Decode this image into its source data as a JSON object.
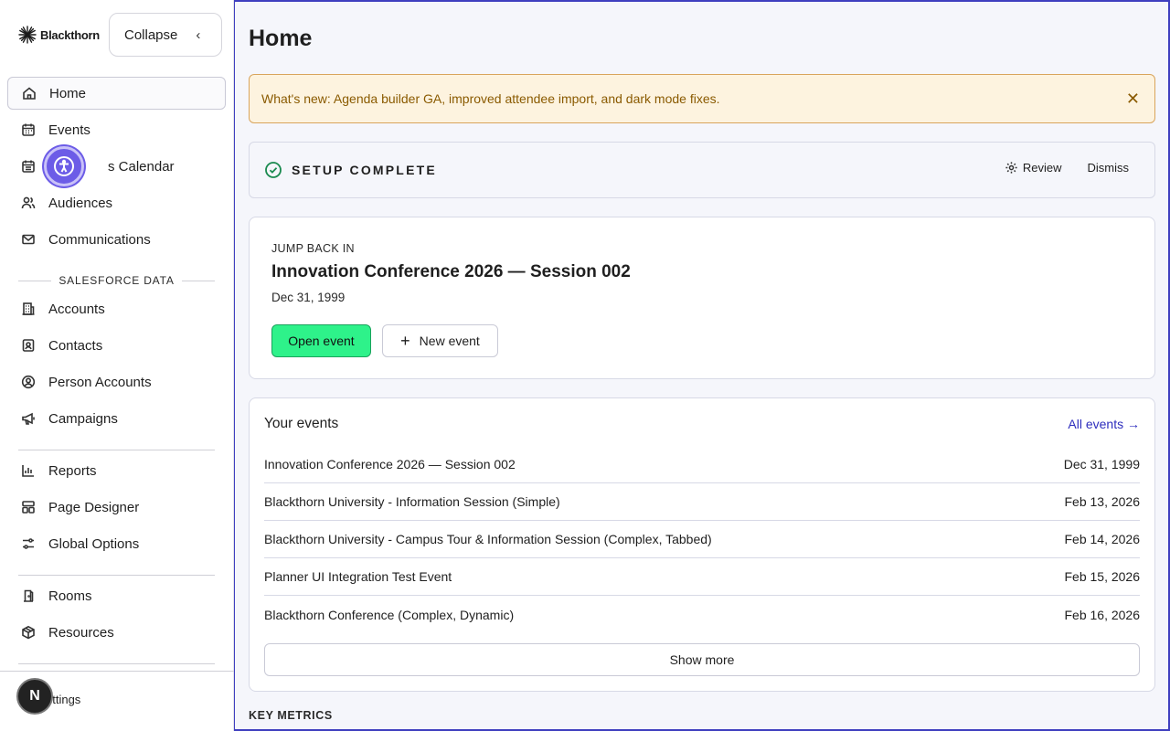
{
  "brand": {
    "name": "Blackthorn"
  },
  "sidebar": {
    "collapse_label": "Collapse",
    "primary": [
      {
        "label": "Home",
        "icon": "home-icon"
      },
      {
        "label": "Events",
        "icon": "calendar-icon"
      },
      {
        "label": "Events Calendar",
        "icon": "calendar-icon",
        "visible_label": "s Calendar"
      },
      {
        "label": "Audiences",
        "icon": "users-icon"
      },
      {
        "label": "Communications",
        "icon": "mail-icon"
      }
    ],
    "salesforce_section_title": "SALESFORCE DATA",
    "salesforce": [
      {
        "label": "Accounts",
        "icon": "building-icon"
      },
      {
        "label": "Contacts",
        "icon": "contact-icon"
      },
      {
        "label": "Person Accounts",
        "icon": "person-circle-icon"
      },
      {
        "label": "Campaigns",
        "icon": "megaphone-icon"
      }
    ],
    "tools": [
      {
        "label": "Reports",
        "icon": "bar-chart-icon"
      },
      {
        "label": "Page Designer",
        "icon": "layout-icon"
      },
      {
        "label": "Global Options",
        "icon": "sliders-icon"
      }
    ],
    "resources": [
      {
        "label": "Rooms",
        "icon": "door-icon"
      },
      {
        "label": "Resources",
        "icon": "box-icon"
      }
    ],
    "settings_label": "ettings",
    "avatar_initial": "N"
  },
  "main": {
    "title": "Home",
    "banner": {
      "text": "What's new: Agenda builder GA, improved attendee import, and dark mode fixes.",
      "close": "✕"
    },
    "setup": {
      "title": "SETUP COMPLETE",
      "review_label": "Review",
      "dismiss_label": "Dismiss"
    },
    "jump": {
      "label": "JUMP BACK IN",
      "title": "Innovation Conference 2026 — Session 002",
      "date": "Dec 31, 1999",
      "open_label": "Open event",
      "new_label": "New event"
    },
    "events": {
      "title": "Your events",
      "all_label": "All events →",
      "rows": [
        {
          "name": "Innovation Conference 2026 — Session 002",
          "date": "Dec 31, 1999"
        },
        {
          "name": "Blackthorn University - Information Session (Simple)",
          "date": "Feb 13, 2026"
        },
        {
          "name": "Blackthorn University - Campus Tour & Information Session (Complex, Tabbed)",
          "date": "Feb 14, 2026"
        },
        {
          "name": "Planner UI Integration Test Event",
          "date": "Feb 15, 2026"
        },
        {
          "name": "Blackthorn Conference (Complex, Dynamic)",
          "date": "Feb 16, 2026"
        }
      ],
      "show_more_label": "Show more"
    },
    "key_metrics_label": "KEY METRICS"
  },
  "colors": {
    "accent": "#2d2dbd",
    "success": "#2ef28a",
    "banner_bg": "#fdf3df",
    "banner_text": "#8a5a00",
    "a11y": "#6c5ce7"
  }
}
